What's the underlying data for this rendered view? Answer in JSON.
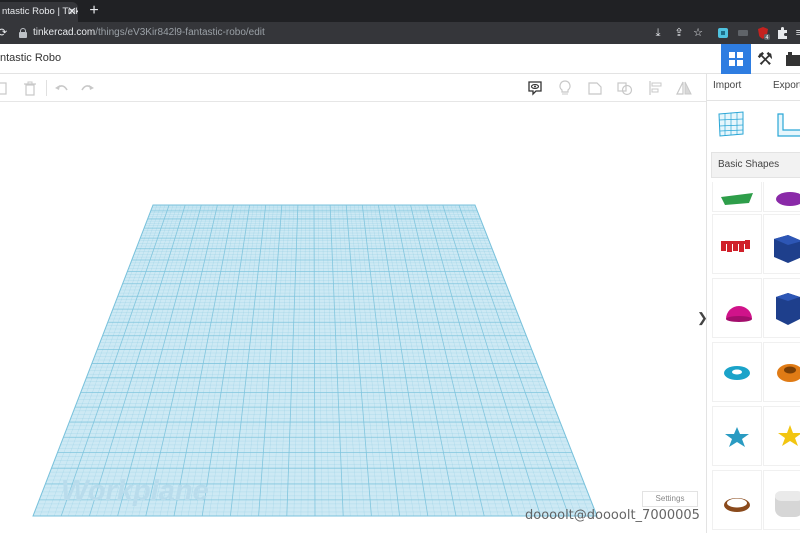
{
  "browser": {
    "tab_title": "ntastic Robo | Tinke",
    "url_host": "tinkercad.com",
    "url_path": "/things/eV3Kir842l9-fantastic-robo/edit",
    "extension_badge": "4"
  },
  "app": {
    "design_title": "ntastic Robo"
  },
  "panel": {
    "import_label": "Import",
    "export_label": "Export",
    "library_label": "Basic Shapes"
  },
  "canvas": {
    "workplane_label": "Workplane",
    "settings_label": "Settings",
    "toggle_glyph": "❯"
  },
  "overlay": {
    "watermark_text": "doooolt@doooolt_7000005"
  },
  "colors": {
    "accent": "#2e7de1",
    "grid_fill": "#cde9f4",
    "grid_line": "#7ac2dc",
    "workplane_text": "#b9dcec"
  },
  "shape_icons": [
    "box-green-icon",
    "sphere-purple-icon",
    "text-red-icon",
    "cube-blue-icon",
    "half-sphere-pink-icon",
    "polygon-blue-icon",
    "torus-teal-icon",
    "tube-orange-icon",
    "star-teal-icon",
    "star-yellow-icon",
    "ring-brown-icon",
    "rounded-box-grey-icon"
  ]
}
